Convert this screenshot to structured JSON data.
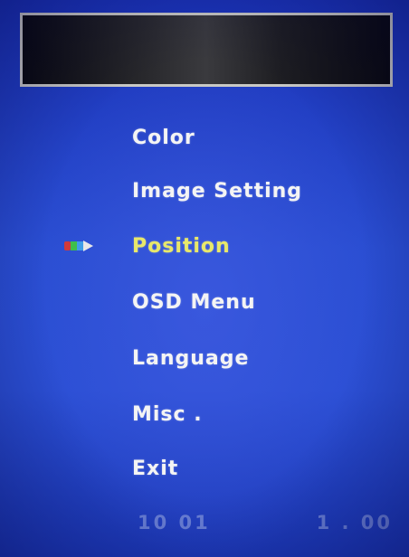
{
  "menu": {
    "items": [
      {
        "label": "Color"
      },
      {
        "label": "Image  Setting"
      },
      {
        "label": "Position"
      },
      {
        "label": "OSD  Menu"
      },
      {
        "label": "Language"
      },
      {
        "label": "Misc ."
      },
      {
        "label": "Exit"
      }
    ],
    "selected_index": 2,
    "selected_color": "#e8e86a",
    "text_color": "#f4f4f4"
  },
  "footer": {
    "date": "10  01",
    "version": "1 . 00"
  },
  "colors": {
    "background": "#2a4ed2",
    "title_box_border": "#c9c9c4",
    "title_box_fill": "#1e1e22"
  },
  "icons": {
    "pointer": "arrow-pointer-icon"
  }
}
